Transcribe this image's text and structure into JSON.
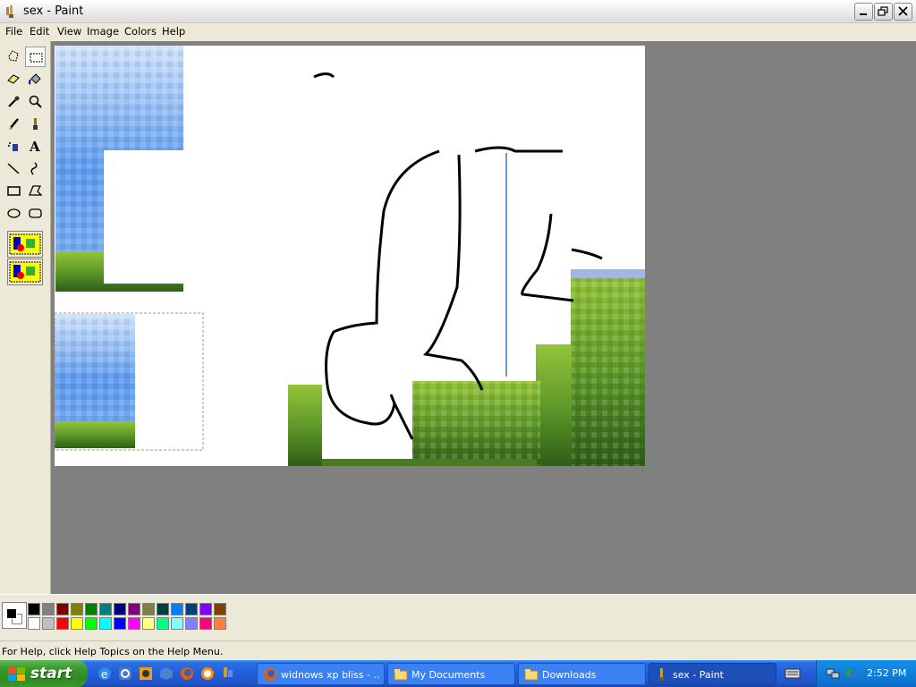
{
  "window": {
    "title": "sex - Paint"
  },
  "menu": [
    "File",
    "Edit",
    "View",
    "Image",
    "Colors",
    "Help"
  ],
  "tools": [
    "free-form-select",
    "select",
    "eraser",
    "fill-with-color",
    "pick-color",
    "magnifier",
    "pencil",
    "brush",
    "airbrush",
    "text",
    "line",
    "curve",
    "rectangle",
    "polygon",
    "ellipse",
    "rounded-rectangle"
  ],
  "palette": {
    "foreground": "#000000",
    "background": "#ffffff",
    "row1": [
      "#000000",
      "#808080",
      "#800000",
      "#808000",
      "#008000",
      "#008080",
      "#000080",
      "#800080",
      "#808040",
      "#004040",
      "#0080ff",
      "#004080",
      "#8000ff",
      "#804000"
    ],
    "row2": [
      "#ffffff",
      "#c0c0c0",
      "#ff0000",
      "#ffff00",
      "#00ff00",
      "#00ffff",
      "#0000ff",
      "#ff00ff",
      "#ffff80",
      "#00ff80",
      "#80ffff",
      "#8080ff",
      "#ff0080",
      "#ff8040"
    ]
  },
  "status": {
    "text": "For Help, click Help Topics on the Help Menu."
  },
  "taskbar": {
    "start_label": "start",
    "quick_launch": [
      "ie-icon",
      "sync-icon",
      "media-icon",
      "3d-icon",
      "firefox-icon",
      "messenger-icon"
    ],
    "tasks": [
      {
        "label": "widnows xp bliss - ...",
        "icon": "firefox-icon",
        "active": false
      },
      {
        "label": "My Documents",
        "icon": "folder-icon",
        "active": false
      },
      {
        "label": "Downloads",
        "icon": "folder-icon",
        "active": false
      },
      {
        "label": "sex - Paint",
        "icon": "paint-icon",
        "active": true
      }
    ],
    "clock": "2:52 PM"
  }
}
